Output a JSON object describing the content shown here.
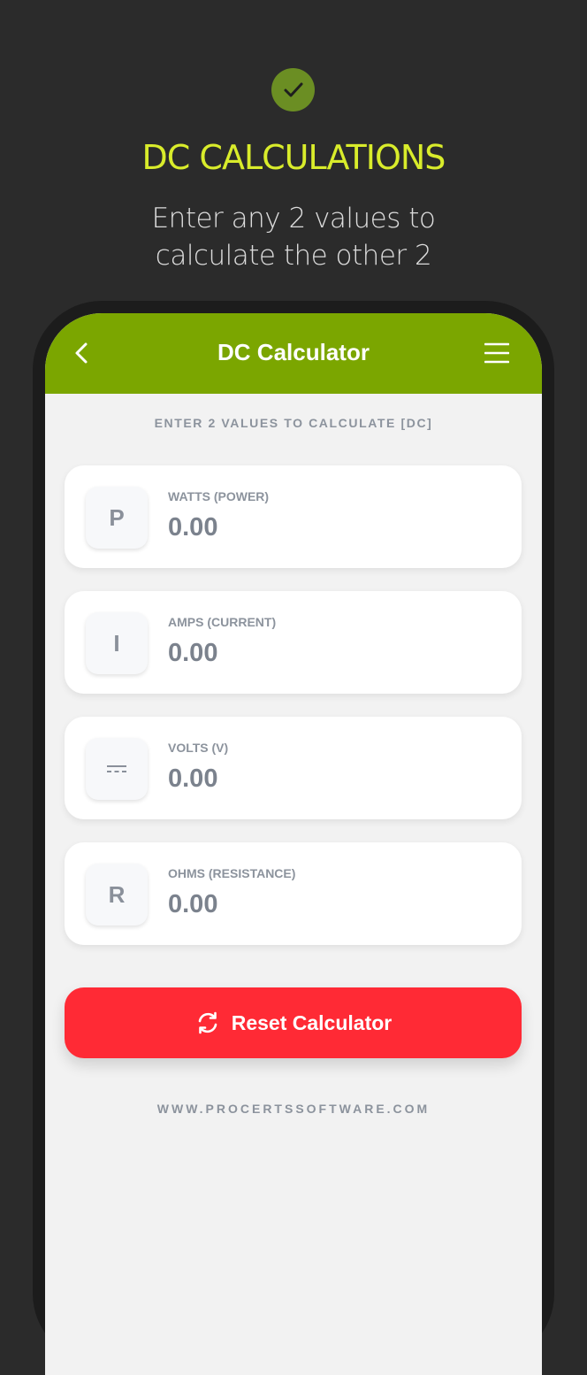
{
  "promo": {
    "title": "DC CALCULATIONS",
    "subtitle_line1": "Enter any 2 values to",
    "subtitle_line2": "calculate the other 2"
  },
  "header": {
    "title": "DC Calculator"
  },
  "instructions": "ENTER 2 VALUES TO CALCULATE [DC]",
  "fields": [
    {
      "symbol": "P",
      "label": "WATTS (POWER)",
      "value": "0.00"
    },
    {
      "symbol": "I",
      "label": "AMPS (CURRENT)",
      "value": "0.00"
    },
    {
      "symbol": "",
      "icon": "dc-symbol-icon",
      "label": "VOLTS (V)",
      "value": "0.00"
    },
    {
      "symbol": "R",
      "label": "OHMS (RESISTANCE)",
      "value": "0.00"
    }
  ],
  "reset": {
    "label": "Reset Calculator",
    "icon": "refresh-icon"
  },
  "footer": "WWW.PROCERTSSOFTWARE.COM",
  "colors": {
    "background": "#2b2b2b",
    "accent_green": "#7ba600",
    "title_yellow": "#d9ec2b",
    "reset_red": "#ff2a35"
  }
}
